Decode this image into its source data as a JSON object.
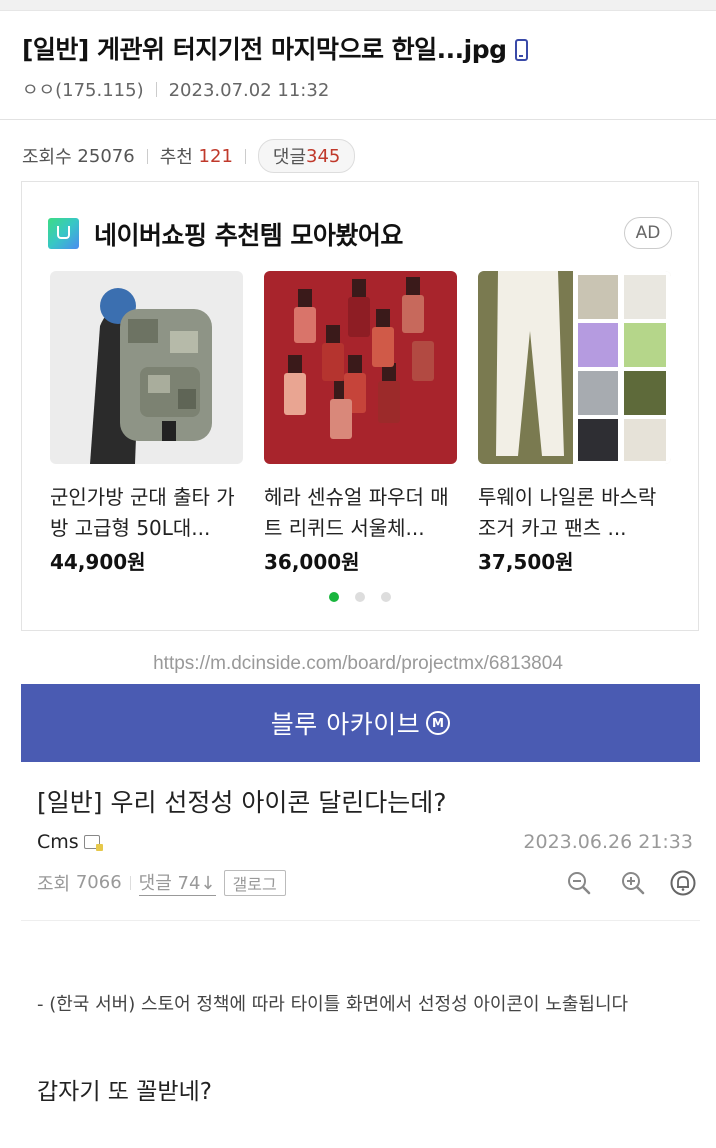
{
  "post": {
    "title": "[일반] 게관위 터지기전 마지막으로 한일...jpg",
    "title_icon": "mobile-icon",
    "author": "ㅇㅇ(175.115)",
    "datetime": "2023.07.02 11:32",
    "views_label": "조회수",
    "views": "25076",
    "recommend_label": "추천",
    "recommend": "121",
    "comments_label": "댓글",
    "comments": "345"
  },
  "ad": {
    "title": "네이버쇼핑 추천템 모아봤어요",
    "badge": "AD",
    "products": [
      {
        "name": "군인가방 군대 출타 가방 고급형 50L대...",
        "price": "44,900원",
        "image": "camo-backpack"
      },
      {
        "name": "헤라 센슈얼 파우더 매트 리퀴드 서울체...",
        "price": "36,000원",
        "image": "lip-tint-bottles"
      },
      {
        "name": "투웨이 나일론 바스락 조거 카고 팬츠 ...",
        "price": "37,500원",
        "image": "cargo-pants"
      }
    ],
    "pagination": {
      "total": 3,
      "active": 1
    },
    "active_dot_color": "#19b53d"
  },
  "embedded": {
    "url": "https://m.dcinside.com/board/projectmx/6813804",
    "banner_title": "블루 아카이브",
    "banner_badge": "M",
    "banner_color": "#4a5bb2",
    "post_title": "[일반] 우리 선정성 아이콘 달린다는데?",
    "author": "Cms",
    "datetime": "2023.06.26 21:33",
    "views_label": "조회",
    "views": "7066",
    "comments_label": "댓글",
    "comments": "74↓",
    "gallogo_label": "갤로그",
    "notice": "- (한국 서버) 스토어 정책에 따라 타이틀 화면에서 선정성 아이콘이 노출됩니다",
    "body_line": "갑자기 또 꼴받네?"
  }
}
